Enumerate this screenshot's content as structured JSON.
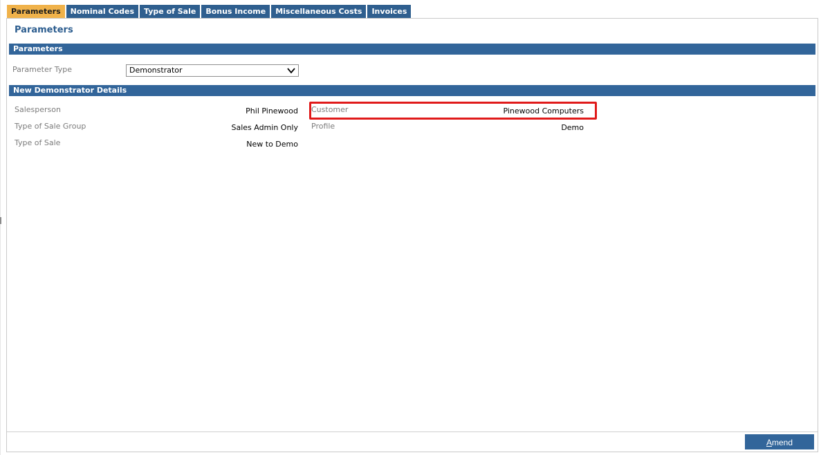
{
  "tabs": [
    {
      "label": "Parameters",
      "active": true
    },
    {
      "label": "Nominal Codes",
      "active": false
    },
    {
      "label": "Type of Sale",
      "active": false
    },
    {
      "label": "Bonus Income",
      "active": false
    },
    {
      "label": "Miscellaneous Costs",
      "active": false
    },
    {
      "label": "Invoices",
      "active": false
    }
  ],
  "page_title": "Parameters",
  "parameters_section": {
    "title": "Parameters",
    "parameter_type_label": "Parameter Type",
    "parameter_type_value": "Demonstrator"
  },
  "details_section": {
    "title": "New Demonstrator Details",
    "salesperson_label": "Salesperson",
    "salesperson_value": "Phil Pinewood",
    "type_of_sale_group_label": "Type of Sale Group",
    "type_of_sale_group_value": "Sales Admin Only",
    "type_of_sale_label": "Type of Sale",
    "type_of_sale_value": "New to Demo",
    "customer_label": "Customer",
    "customer_value": "Pinewood Computers",
    "profile_label": "Profile",
    "profile_value": "Demo"
  },
  "footer": {
    "amend_first": "A",
    "amend_rest": "mend"
  },
  "colors": {
    "active_tab": "#f0b24a",
    "tab_bar": "#2f5f8f",
    "section_bar": "#32659a",
    "highlight": "#e01a1a"
  },
  "icons": {
    "dropdown": "chevron-down-icon"
  }
}
